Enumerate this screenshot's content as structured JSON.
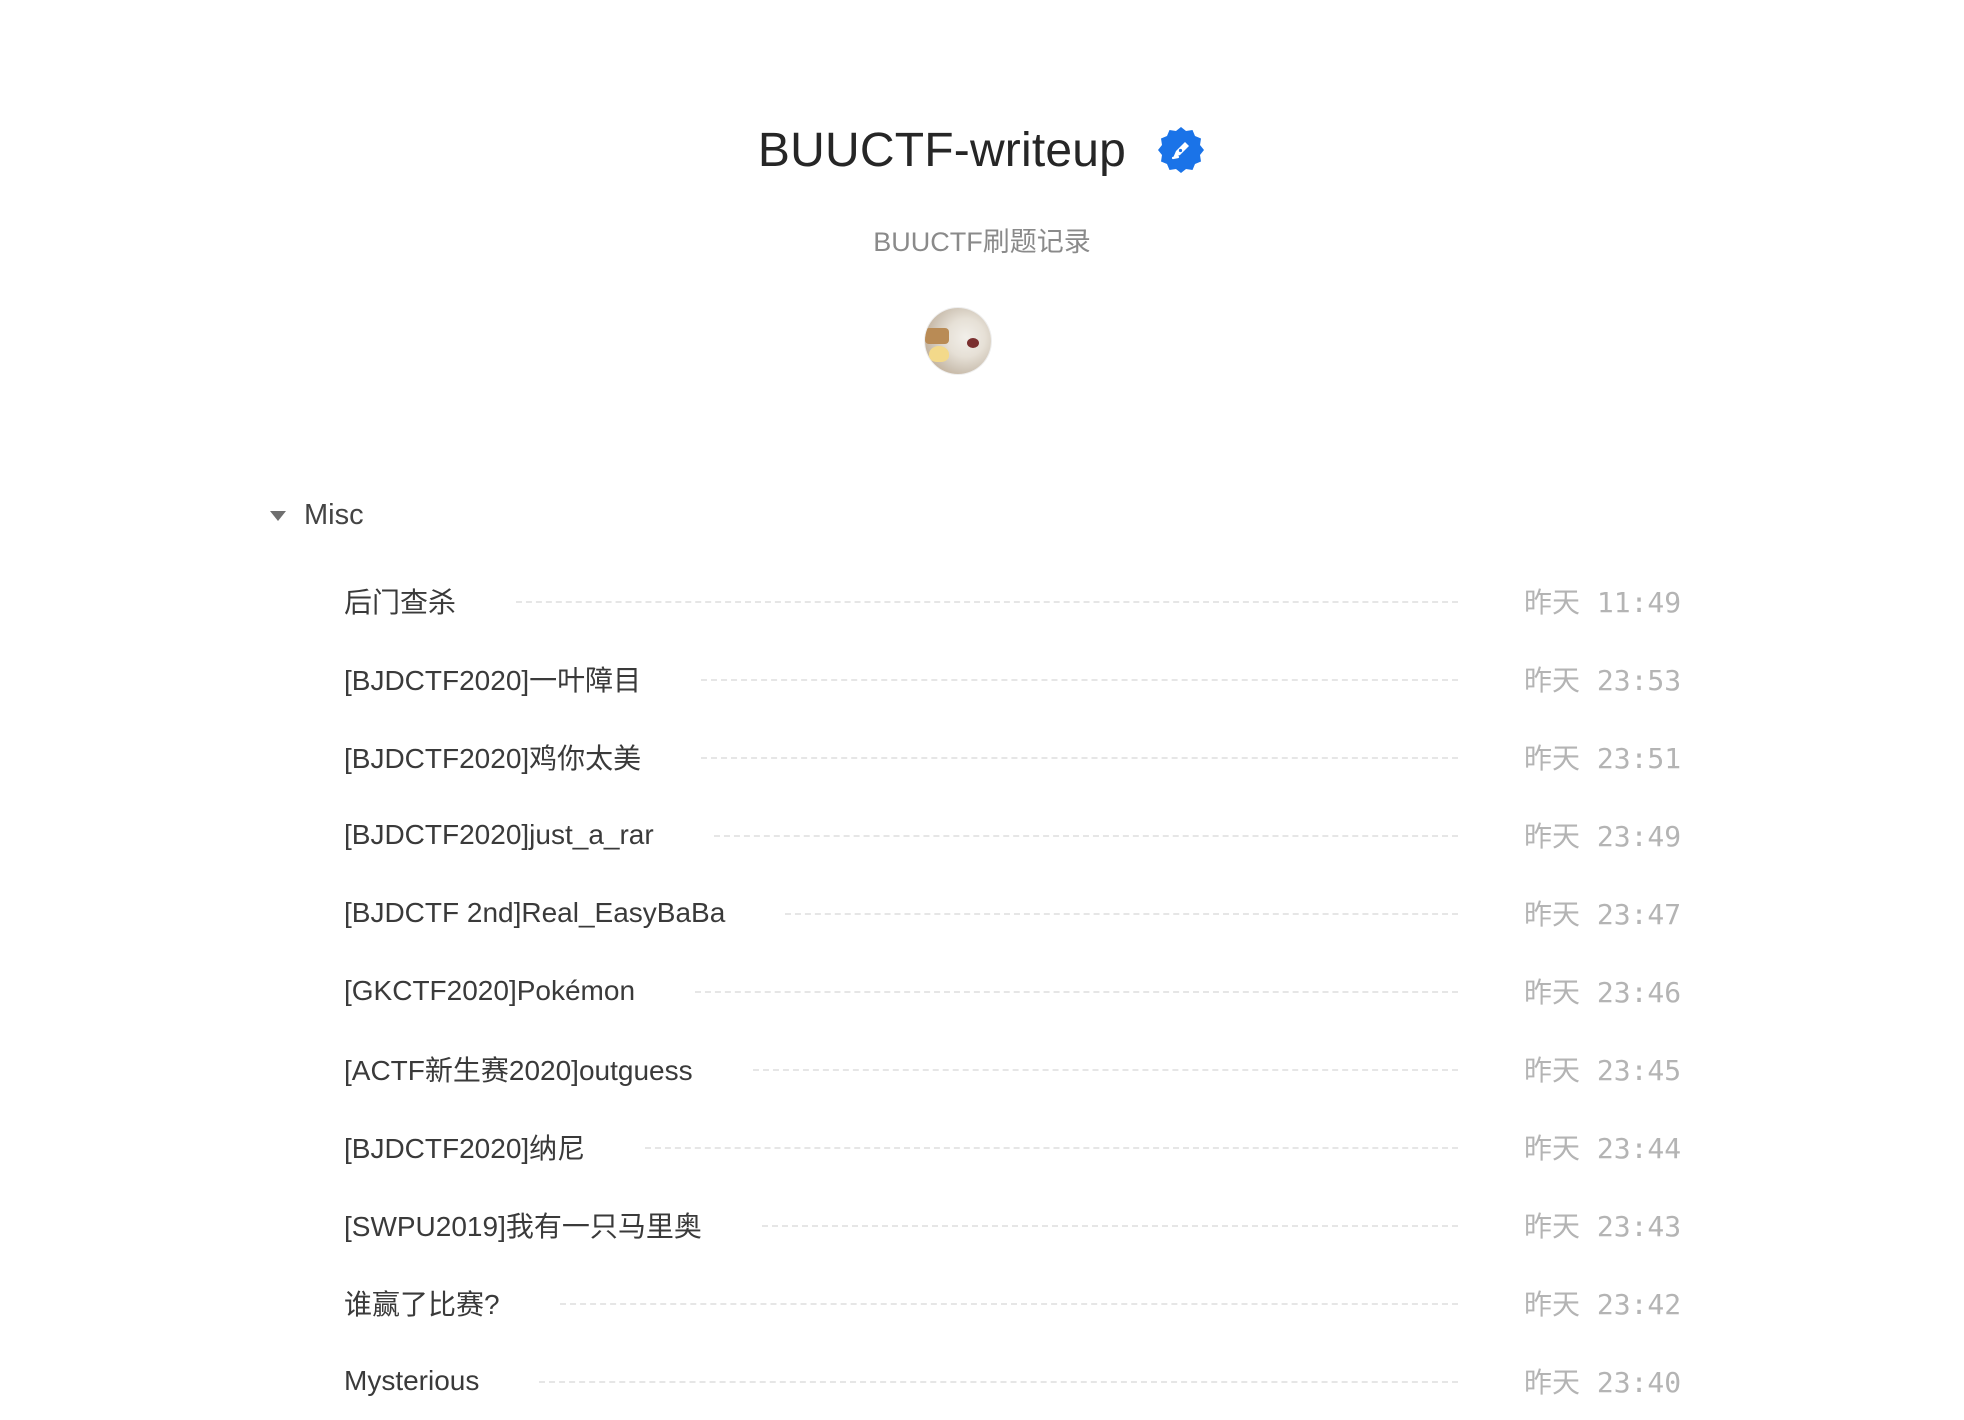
{
  "book": {
    "title": "BUUCTF-writeup",
    "subtitle": "BUUCTF刷题记录",
    "verified_icon": "verified-badge-icon",
    "accent_color": "#1a73e8"
  },
  "section": {
    "title": "Misc",
    "items": [
      {
        "title": "后门查杀",
        "time": "昨天 11:49"
      },
      {
        "title": "[BJDCTF2020]一叶障目",
        "time": "昨天 23:53"
      },
      {
        "title": "[BJDCTF2020]鸡你太美",
        "time": "昨天 23:51"
      },
      {
        "title": "[BJDCTF2020]just_a_rar",
        "time": "昨天 23:49"
      },
      {
        "title": "[BJDCTF 2nd]Real_EasyBaBa",
        "time": "昨天 23:47"
      },
      {
        "title": "[GKCTF2020]Pokémon",
        "time": "昨天 23:46"
      },
      {
        "title": "[ACTF新生赛2020]outguess",
        "time": "昨天 23:45"
      },
      {
        "title": "[BJDCTF2020]纳尼",
        "time": "昨天 23:44"
      },
      {
        "title": "[SWPU2019]我有一只马里奥",
        "time": "昨天 23:43"
      },
      {
        "title": "谁赢了比赛?",
        "time": "昨天 23:42"
      },
      {
        "title": "Mysterious",
        "time": "昨天 23:40"
      }
    ]
  }
}
